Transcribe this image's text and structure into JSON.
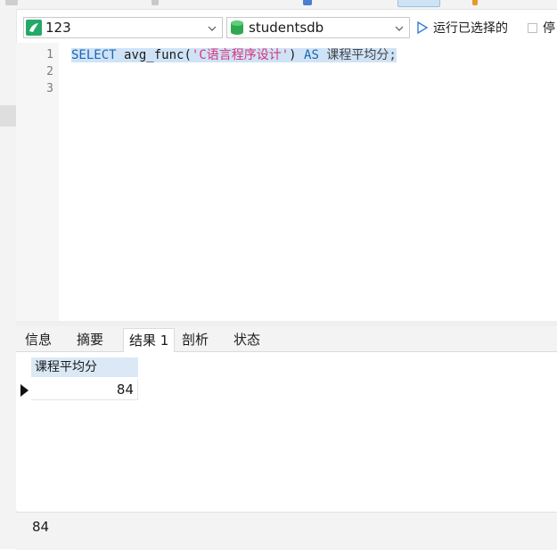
{
  "toolbar": {
    "connection": "123",
    "database": "studentsdb",
    "run_selected_label": "运行已选择的",
    "stop_label": "停"
  },
  "editor": {
    "line_numbers": [
      "1",
      "2",
      "3"
    ],
    "code": {
      "kw_select": "SELECT",
      "func": "avg_func(",
      "string": "'C语言程序设计'",
      "close": ")",
      "kw_as": "AS",
      "alias": "课程平均分;"
    }
  },
  "results": {
    "tabs": [
      "信息",
      "摘要",
      "结果 1",
      "剖析",
      "状态"
    ],
    "active_tab": "结果 1",
    "columns": [
      "课程平均分"
    ],
    "rows": [
      [
        "84"
      ]
    ]
  },
  "value_panel": {
    "value": "84"
  },
  "colors": {
    "keyword": "#1d66b0",
    "string": "#d7337a",
    "selection": "#cfe3f7",
    "header": "#dbe9f7",
    "db_icon": "#2fa84f",
    "conn_icon": "#24a868",
    "run_icon": "#3a7bd5"
  }
}
